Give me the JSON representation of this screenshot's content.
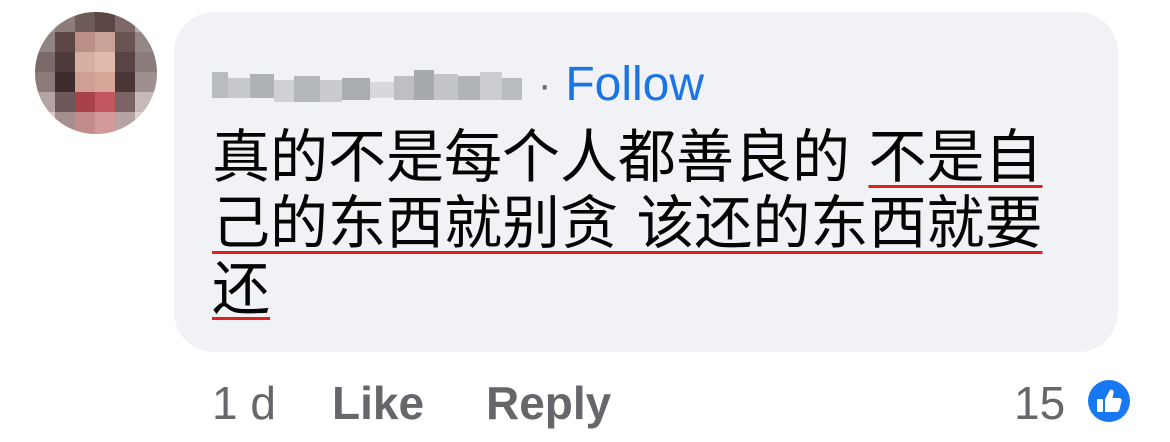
{
  "comment": {
    "author": "Nguyen Linh",
    "separator": "·",
    "follow_label": "Follow",
    "text": "真的不是每个人都善良的 不是自己的东西就别贪 该还的东西就要还",
    "text_plain": "真的不是每个人都善良的 ",
    "text_underlined": "不是自己的东西就别贪 该还的东西就要还"
  },
  "actions": {
    "time": "1 d",
    "like_label": "Like",
    "reply_label": "Reply"
  },
  "reactions": {
    "count": "15",
    "icon": "thumbs-up-icon",
    "color": "#1877f2"
  },
  "colors": {
    "bubble": "#f0f2f5",
    "link": "#1b74e4",
    "text": "#050505",
    "meta": "#65676b",
    "spellcheck": "#e02020"
  }
}
